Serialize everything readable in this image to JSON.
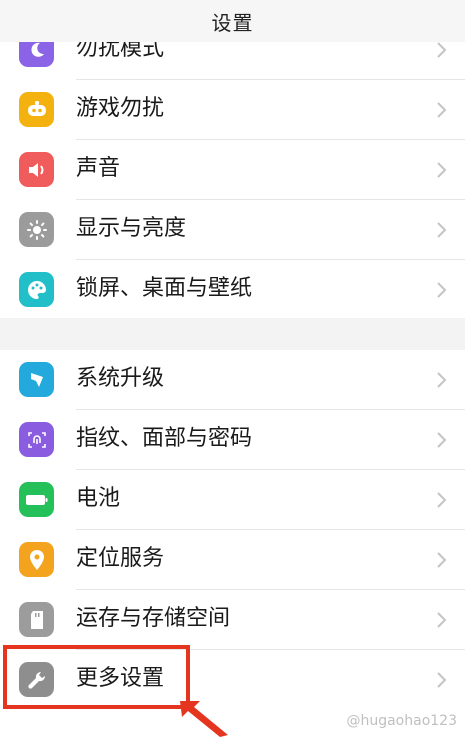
{
  "header": {
    "title": "设置"
  },
  "group1": [
    {
      "label": "勿扰模式",
      "icon": "moon-icon",
      "color": "#8b63e6"
    },
    {
      "label": "游戏勿扰",
      "icon": "game-controller-icon",
      "color": "#f3b20f"
    },
    {
      "label": "声音",
      "icon": "speaker-icon",
      "color": "#f05b5b"
    },
    {
      "label": "显示与亮度",
      "icon": "sun-icon",
      "color": "#9b9b9b"
    },
    {
      "label": "锁屏、桌面与壁纸",
      "icon": "palette-icon",
      "color": "#22bfc8"
    }
  ],
  "group2": [
    {
      "label": "系统升级",
      "icon": "system-update-icon",
      "color": "#23a9dc"
    },
    {
      "label": "指纹、面部与密码",
      "icon": "fingerprint-icon",
      "color": "#8a5ce0"
    },
    {
      "label": "电池",
      "icon": "battery-icon",
      "color": "#25c05a"
    },
    {
      "label": "定位服务",
      "icon": "location-pin-icon",
      "color": "#f3a31e"
    },
    {
      "label": "运存与存储空间",
      "icon": "sd-card-icon",
      "color": "#9c9c9c"
    },
    {
      "label": "更多设置",
      "icon": "wrench-icon",
      "color": "#8e8e8e"
    }
  ],
  "annotation": {
    "highlight_color": "#e5351e"
  },
  "watermark": "@hugaohao123"
}
